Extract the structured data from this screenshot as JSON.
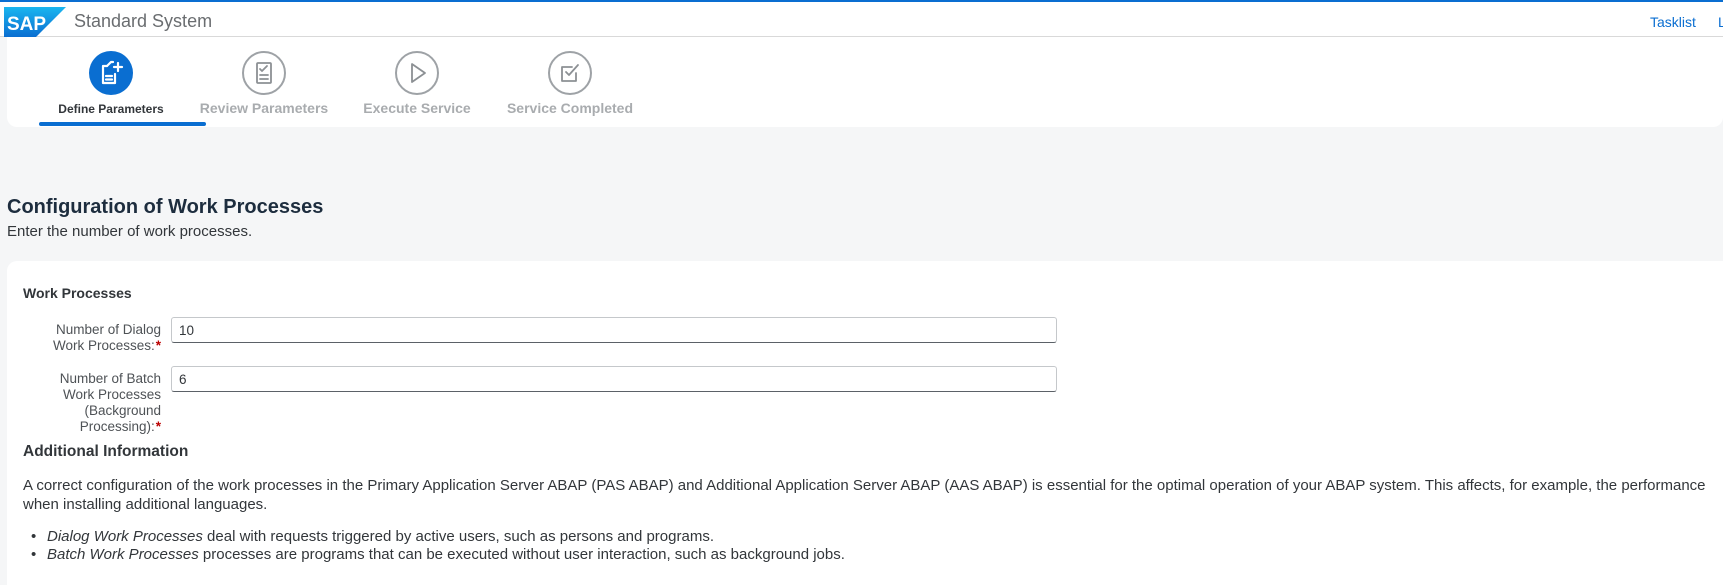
{
  "header": {
    "title": "Standard System",
    "logo_text": "SAP",
    "links": [
      "Tasklist",
      "L"
    ]
  },
  "wizard": {
    "steps": [
      {
        "label": "Define Parameters",
        "state": "active",
        "icon": "create-form-icon"
      },
      {
        "label": "Review Parameters",
        "state": "inactive",
        "icon": "checklist-icon"
      },
      {
        "label": "Execute Service",
        "state": "inactive",
        "icon": "play-icon"
      },
      {
        "label": "Service Completed",
        "state": "inactive",
        "icon": "checkbox-icon"
      }
    ]
  },
  "page": {
    "title": "Configuration of Work Processes",
    "subtitle": "Enter the number of work processes."
  },
  "form": {
    "section_title": "Work Processes",
    "dialog_label": "Number of Dialog Work Processes:",
    "dialog_label_line1": "Number of Dialog",
    "dialog_label_line2": "Work Processes:",
    "dialog_value": "10",
    "batch_label_line1": "Number of Batch",
    "batch_label_line2": "Work Processes",
    "batch_label_line3": "(Background",
    "batch_label_line4": "Processing):",
    "batch_value": "6",
    "required_marker": "*"
  },
  "info": {
    "title": "Additional Information",
    "paragraph": "A correct configuration of the work processes in the Primary Application Server ABAP (PAS ABAP) and Additional Application Server ABAP (AAS ABAP) is essential for the optimal operation of your ABAP system. This affects, for example, the performance when installing additional languages.",
    "bullets": [
      {
        "term": "Dialog Work Processes",
        "text": " deal with requests triggered by active users, such as persons and programs."
      },
      {
        "term": "Batch Work Processes",
        "text": " processes are programs that can be executed without user interaction, such as background jobs."
      }
    ]
  },
  "colors": {
    "accent": "#0a6ed1",
    "required": "#bb0000",
    "background": "#f5f6f7"
  }
}
